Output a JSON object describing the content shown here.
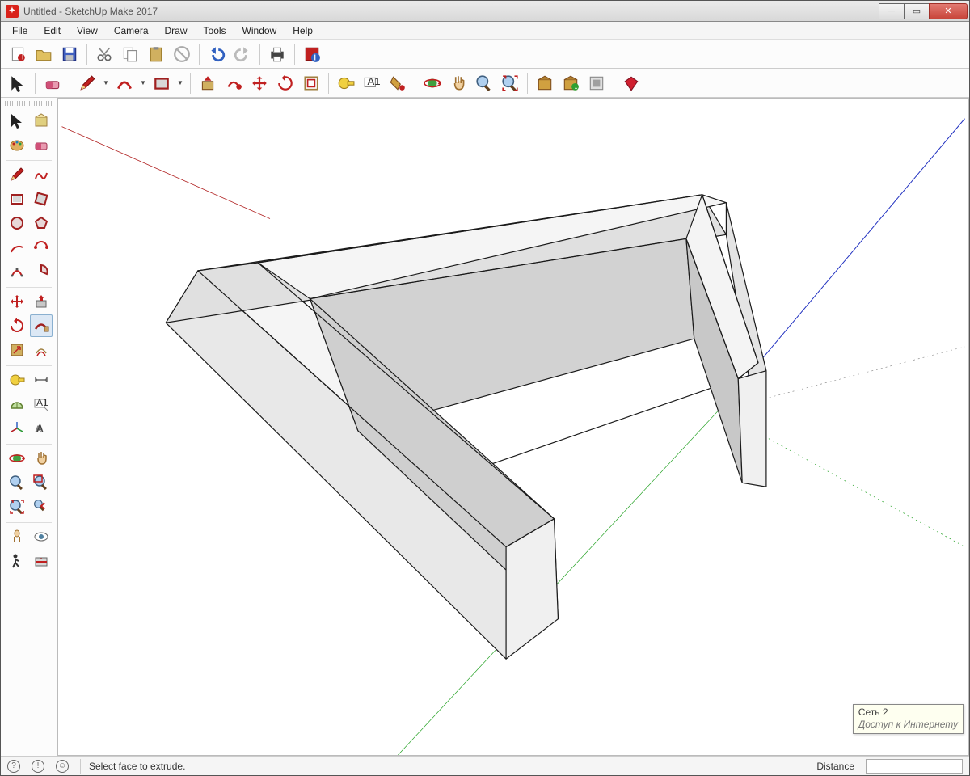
{
  "window": {
    "title": "Untitled - SketchUp Make 2017"
  },
  "menu": {
    "items": [
      "File",
      "Edit",
      "View",
      "Camera",
      "Draw",
      "Tools",
      "Window",
      "Help"
    ]
  },
  "status": {
    "hint": "Select face to extrude.",
    "vcb_label": "Distance",
    "vcb_value": ""
  },
  "tooltip": {
    "line1": "Сеть 2",
    "line2": "Доступ к Интернету"
  },
  "toolbar1": [
    {
      "name": "new",
      "icon": "new"
    },
    {
      "name": "open",
      "icon": "open"
    },
    {
      "name": "save",
      "icon": "save"
    },
    {
      "sep": true
    },
    {
      "name": "cut",
      "icon": "cut"
    },
    {
      "name": "copy",
      "icon": "copy"
    },
    {
      "name": "paste",
      "icon": "paste"
    },
    {
      "name": "delete",
      "icon": "del"
    },
    {
      "sep": true
    },
    {
      "name": "undo",
      "icon": "undo"
    },
    {
      "name": "redo",
      "icon": "redo"
    },
    {
      "sep": true
    },
    {
      "name": "print",
      "icon": "print"
    },
    {
      "sep": true
    },
    {
      "name": "model-info",
      "icon": "info"
    }
  ],
  "toolbar2": [
    {
      "name": "select",
      "icon": "select"
    },
    {
      "sep": true
    },
    {
      "name": "eraser",
      "icon": "eraser"
    },
    {
      "sep": true
    },
    {
      "name": "pencil",
      "icon": "pencil",
      "dd": true
    },
    {
      "name": "arc",
      "icon": "arc",
      "dd": true
    },
    {
      "name": "rectangle",
      "icon": "rect",
      "dd": true
    },
    {
      "sep": true
    },
    {
      "name": "pushpull",
      "icon": "pushpull"
    },
    {
      "name": "followme",
      "icon": "followme"
    },
    {
      "name": "move",
      "icon": "move"
    },
    {
      "name": "rotate",
      "icon": "rotate"
    },
    {
      "name": "offset",
      "icon": "offset"
    },
    {
      "sep": true
    },
    {
      "name": "tape",
      "icon": "tape"
    },
    {
      "name": "text",
      "icon": "text"
    },
    {
      "name": "paint",
      "icon": "paint"
    },
    {
      "sep": true
    },
    {
      "name": "orbit",
      "icon": "orbit"
    },
    {
      "name": "pan",
      "icon": "pan"
    },
    {
      "name": "zoom",
      "icon": "zoom"
    },
    {
      "name": "zoom-extents",
      "icon": "zoomext"
    },
    {
      "sep": true
    },
    {
      "name": "warehouse",
      "icon": "wh1"
    },
    {
      "name": "warehouse2",
      "icon": "wh2"
    },
    {
      "name": "extensions",
      "icon": "ext"
    },
    {
      "sep": true
    },
    {
      "name": "ruby",
      "icon": "ruby"
    }
  ],
  "sidetools": [
    [
      {
        "name": "select",
        "icon": "select"
      },
      {
        "name": "component",
        "icon": "comp"
      }
    ],
    [
      {
        "name": "paint",
        "icon": "paint2"
      },
      {
        "name": "eraser",
        "icon": "eraser"
      }
    ],
    "sep",
    [
      {
        "name": "line",
        "icon": "pencil"
      },
      {
        "name": "freehand",
        "icon": "free"
      }
    ],
    [
      {
        "name": "rectangle",
        "icon": "rect2"
      },
      {
        "name": "rotated-rect",
        "icon": "rrect"
      }
    ],
    [
      {
        "name": "circle",
        "icon": "circle"
      },
      {
        "name": "polygon",
        "icon": "poly"
      }
    ],
    [
      {
        "name": "arc",
        "icon": "arc2"
      },
      {
        "name": "2pt-arc",
        "icon": "arc3"
      }
    ],
    [
      {
        "name": "3pt-arc",
        "icon": "arc4"
      },
      {
        "name": "pie",
        "icon": "pie"
      }
    ],
    "sep",
    [
      {
        "name": "move",
        "icon": "move"
      },
      {
        "name": "pushpull",
        "icon": "pushpull2"
      }
    ],
    [
      {
        "name": "rotate",
        "icon": "rotate"
      },
      {
        "name": "followme",
        "icon": "followme2",
        "sel": true
      }
    ],
    [
      {
        "name": "scale",
        "icon": "scale"
      },
      {
        "name": "offset",
        "icon": "offset2"
      }
    ],
    "sep",
    [
      {
        "name": "tape",
        "icon": "tape"
      },
      {
        "name": "dimension",
        "icon": "dim"
      }
    ],
    [
      {
        "name": "protractor",
        "icon": "prot"
      },
      {
        "name": "text",
        "icon": "text2"
      }
    ],
    [
      {
        "name": "axes",
        "icon": "axes"
      },
      {
        "name": "3dtext",
        "icon": "3dtext"
      }
    ],
    "sep",
    [
      {
        "name": "orbit",
        "icon": "orbit"
      },
      {
        "name": "pan",
        "icon": "pan"
      }
    ],
    [
      {
        "name": "zoom",
        "icon": "zoom"
      },
      {
        "name": "zoom-window",
        "icon": "zoomwin"
      }
    ],
    [
      {
        "name": "zoom-extents",
        "icon": "zoomext"
      },
      {
        "name": "previous",
        "icon": "prev"
      }
    ],
    "sep",
    [
      {
        "name": "position-camera",
        "icon": "poscam"
      },
      {
        "name": "look-around",
        "icon": "look"
      }
    ],
    [
      {
        "name": "walk",
        "icon": "walk"
      },
      {
        "name": "section",
        "icon": "section"
      }
    ]
  ]
}
